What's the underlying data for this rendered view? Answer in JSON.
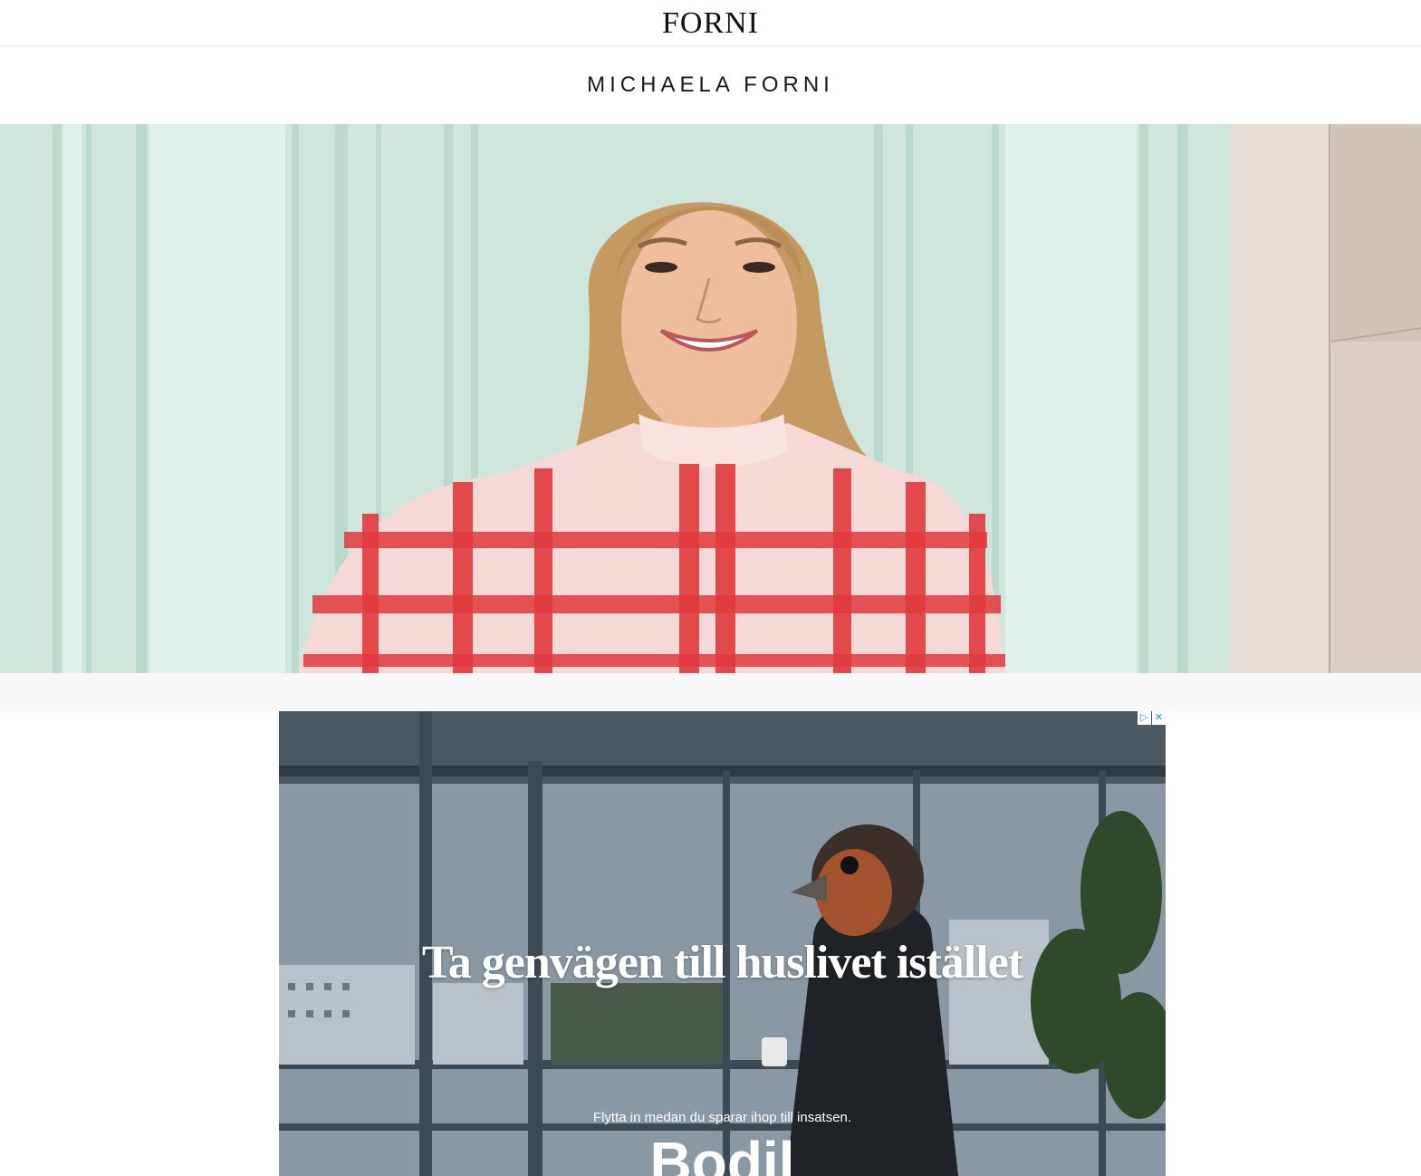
{
  "header": {
    "logo_text": "FORNI"
  },
  "blog": {
    "title": "MICHAELA FORNI"
  },
  "hero": {
    "alt": "Portrait of a smiling woman in a red and white checked blouse in front of a mint green wall"
  },
  "ad": {
    "headline": "Ta genvägen till huslivet istället",
    "subline": "Flytta in medan du sparar ihop till insatsen.",
    "brand": "Bodil",
    "adchoices_icon": "adchoices-icon",
    "close_icon": "close-icon"
  },
  "colors": {
    "wall": "#cfe6dd",
    "blouse_red": "#e03a3e",
    "blouse_pink": "#f6d8d6",
    "ad_sky": "#8a98a3"
  }
}
